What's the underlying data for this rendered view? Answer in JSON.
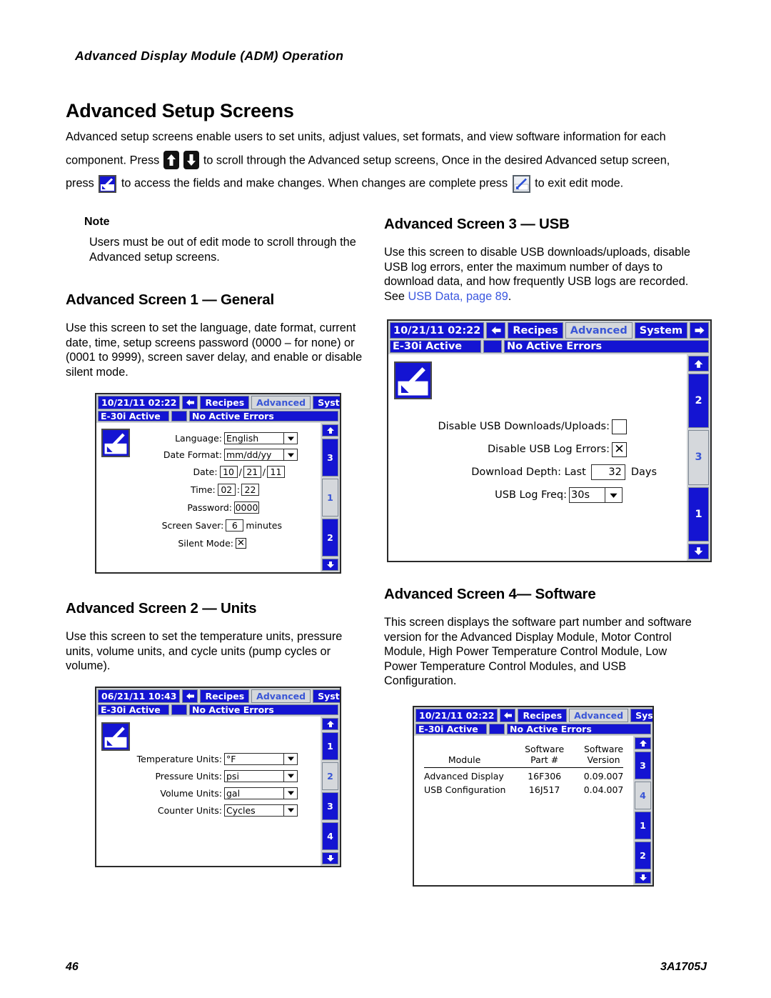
{
  "document": {
    "running_header": "Advanced Display Module (ADM) Operation",
    "title": "Advanced Setup Screens",
    "footer_page": "46",
    "footer_doc": "3A1705J"
  },
  "intro": {
    "part1": "Advanced setup screens enable users to set units, adjust values, set formats, and view software information for each component.  Press",
    "part2": "to scroll through the Advanced setup screens, Once in the desired Advanced setup screen, press",
    "part3": "to access the fields and make changes.  When changes are complete press",
    "part4": "to exit edit mode."
  },
  "note": {
    "label": "Note",
    "body": "Users must be out of edit mode to scroll through the Advanced setup screens."
  },
  "sections": {
    "screen1": {
      "heading": "Advanced Screen 1 — General",
      "body": "Use this screen to set the language, date format, current date, time, setup screens password (0000 – for none) or (0001 to 9999), screen saver delay, and enable or disable silent mode."
    },
    "screen2": {
      "heading": "Advanced Screen 2 — Units",
      "body": "Use this screen to set the temperature units, pressure units, volume units, and cycle units (pump cycles or volume)."
    },
    "screen3": {
      "heading": "Advanced Screen 3 — USB",
      "body_before_link": "Use this screen to disable USB downloads/uploads, disable USB log errors, enter the maximum number of days to download data, and how frequently USB logs are recorded.  See ",
      "link_text": "USB Data, page 89",
      "body_after_link": "."
    },
    "screen4": {
      "heading": "Advanced Screen 4— Software",
      "body": "This screen displays the software part number and software version for the Advanced Display Module, Motor Control Module, High Power Temperature Control Module, Low Power Temperature Control Modules, and USB Configuration."
    }
  },
  "adm_common": {
    "tab_recipes": "Recipes",
    "tab_advanced": "Advanced",
    "tab_system": "System",
    "status_unit": "E-30i Active",
    "status_errors": "No Active Errors",
    "nav_left_icon": "left-arrow-icon",
    "nav_right_icon": "right-arrow-icon",
    "rail_up_icon": "up-arrow-icon",
    "rail_down_icon": "down-arrow-icon"
  },
  "screen1_device": {
    "datetime": "10/21/11 02:22",
    "rail": [
      "3",
      "1",
      "2"
    ],
    "rail_selected": "1",
    "fields": [
      {
        "label": "Language:",
        "type": "combo",
        "value": "English"
      },
      {
        "label": "Date Format:",
        "type": "combo",
        "value": "mm/dd/yy"
      },
      {
        "label": "Date:",
        "type": "date",
        "month": "10",
        "day": "21",
        "year": "11",
        "sep": "/"
      },
      {
        "label": "Time:",
        "type": "time",
        "hour": "02",
        "minute": "22",
        "sep": ":"
      },
      {
        "label": "Password:",
        "type": "num",
        "value": "0000"
      },
      {
        "label": "Screen Saver:",
        "type": "num",
        "value": "6",
        "suffix": "minutes"
      },
      {
        "label": "Silent Mode:",
        "type": "check",
        "checked": true
      }
    ]
  },
  "screen2_device": {
    "datetime": "06/21/11 10:43",
    "rail": [
      "1",
      "2",
      "3",
      "4"
    ],
    "rail_selected": "2",
    "fields": [
      {
        "label": "Temperature Units:",
        "value": "°F"
      },
      {
        "label": "Pressure Units:",
        "value": "psi"
      },
      {
        "label": "Volume Units:",
        "value": "gal"
      },
      {
        "label": "Counter Units:",
        "value": "Cycles"
      }
    ]
  },
  "screen3_device": {
    "datetime": "10/21/11 02:22",
    "rail": [
      "2",
      "3",
      "1"
    ],
    "rail_selected": "3",
    "fields": {
      "disable_downloads_label": "Disable USB Downloads/Uploads:",
      "disable_downloads_checked": false,
      "disable_log_errors_label": "Disable USB Log Errors:",
      "disable_log_errors_checked": true,
      "download_depth_label": "Download Depth: Last",
      "download_depth_value": "32",
      "download_depth_suffix": "Days",
      "usb_log_freq_label": "USB Log Freq:",
      "usb_log_freq_value": "30s"
    }
  },
  "screen4_device": {
    "datetime": "10/21/11 02:22",
    "rail": [
      "3",
      "4",
      "1",
      "2"
    ],
    "rail_selected": "4",
    "table": {
      "headers": [
        "Module",
        "Software\nPart #",
        "Software\nVersion"
      ],
      "header_module": "Module",
      "header_part_l1": "Software",
      "header_part_l2": "Part #",
      "header_ver_l1": "Software",
      "header_ver_l2": "Version",
      "rows": [
        {
          "module": "Advanced Display",
          "part": "16F306",
          "version": "0.09.007"
        },
        {
          "module": "USB Configuration",
          "part": "16J517",
          "version": "0.04.007"
        }
      ]
    }
  },
  "colors": {
    "device_blue": "#1414d2",
    "device_chrome": "#cfd2d6",
    "selected_tab_bg": "#d5d8dc",
    "selected_tab_text": "#3a56d6",
    "link": "#3b57df"
  }
}
